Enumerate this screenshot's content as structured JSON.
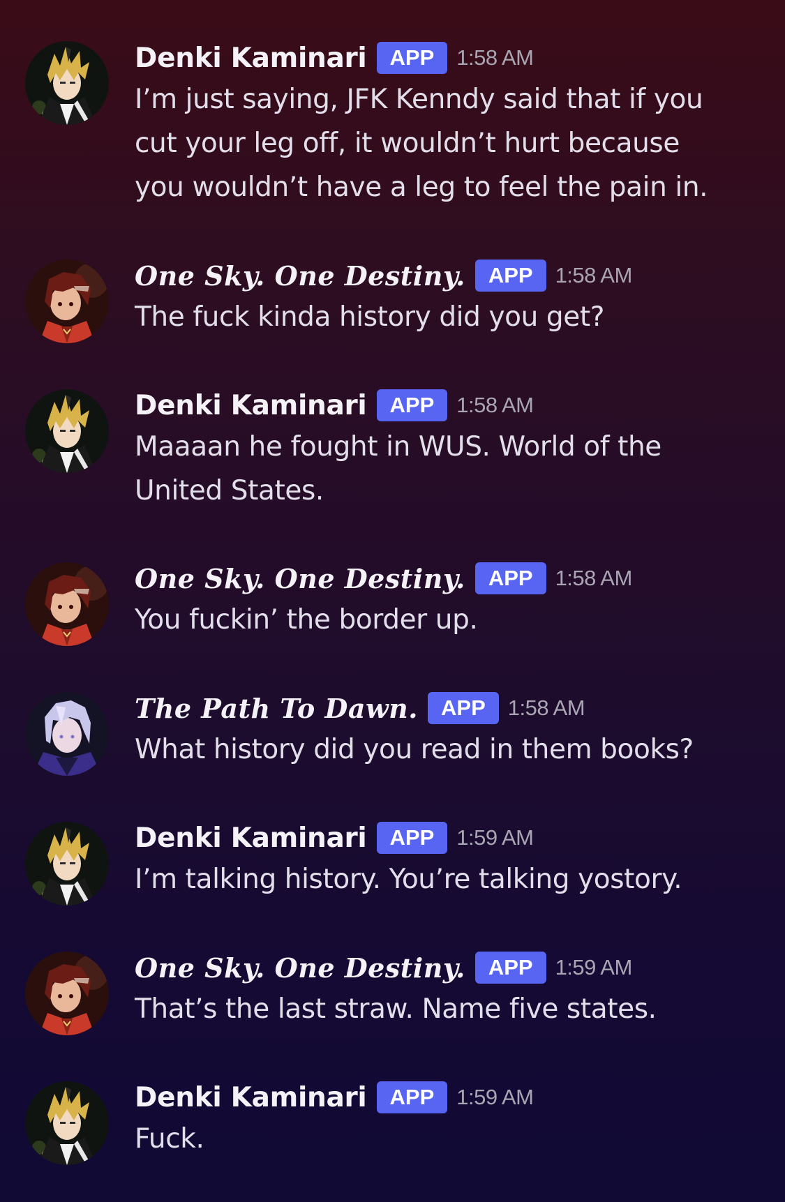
{
  "messages": [
    {
      "author": "Denki Kaminari",
      "author_style": "plain",
      "avatar": "denki-avatar",
      "badge": "APP",
      "time": "1:58 AM",
      "text": "I’m just saying, JFK Kenndy said that if you\ncut your leg off, it wouldn’t hurt because\nyou wouldn’t have a leg to feel the pain in."
    },
    {
      "author": "One Sky. One Destiny.",
      "author_style": "fancy",
      "avatar": "redhair-avatar",
      "badge": "APP",
      "time": "1:58 AM",
      "text": "The fuck kinda history did you get?"
    },
    {
      "author": "Denki Kaminari",
      "author_style": "plain",
      "avatar": "denki-avatar",
      "badge": "APP",
      "time": "1:58 AM",
      "text": "Maaaan he fought in WUS. World of the\nUnited States."
    },
    {
      "author": "One Sky. One Destiny.",
      "author_style": "fancy",
      "avatar": "redhair-avatar",
      "badge": "APP",
      "time": "1:58 AM",
      "text": "You fuckin’ the border up."
    },
    {
      "author": "The Path To Dawn.",
      "author_style": "fancy",
      "avatar": "whitehair-avatar",
      "badge": "APP",
      "time": "1:58 AM",
      "text": "What history did you read in them books?"
    },
    {
      "author": "Denki Kaminari",
      "author_style": "plain",
      "avatar": "denki-avatar",
      "badge": "APP",
      "time": "1:59 AM",
      "text": "I’m talking history. You’re talking yostory."
    },
    {
      "author": "One Sky. One Destiny.",
      "author_style": "fancy",
      "avatar": "redhair-avatar",
      "badge": "APP",
      "time": "1:59 AM",
      "text": "That’s the last straw. Name five states."
    },
    {
      "author": "Denki Kaminari",
      "author_style": "plain",
      "avatar": "denki-avatar",
      "badge": "APP",
      "time": "1:59 AM",
      "text": "Fuck."
    }
  ],
  "colors": {
    "badge_bg": "#5865f2",
    "text": "#e2deea",
    "timestamp": "#a9a5b3"
  }
}
